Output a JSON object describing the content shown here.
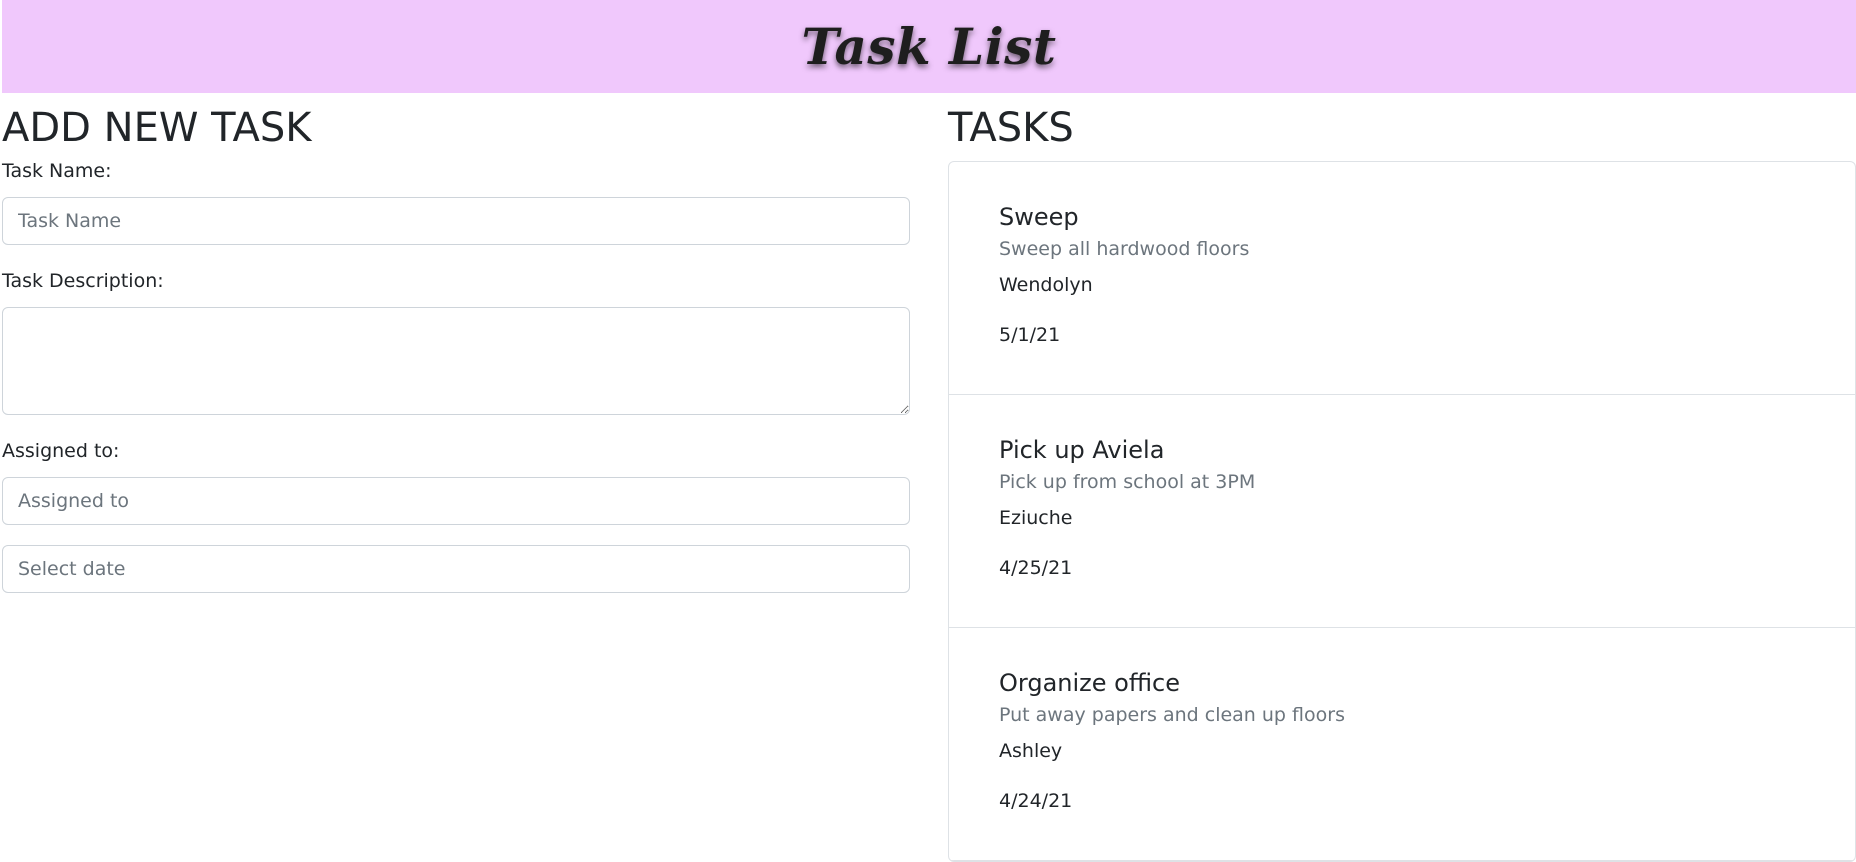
{
  "header": {
    "title": "Task List"
  },
  "form": {
    "heading": "ADD NEW TASK",
    "task_name_label": "Task Name:",
    "task_name_placeholder": "Task Name",
    "task_description_label": "Task Description:",
    "task_description_value": "",
    "assigned_to_label": "Assigned to:",
    "assigned_to_placeholder": "Assigned to",
    "date_placeholder": "Select date"
  },
  "tasks": {
    "heading": "TASKS",
    "items": [
      {
        "name": "Sweep",
        "description": "Sweep all hardwood floors",
        "assignee": "Wendolyn",
        "date": "5/1/21"
      },
      {
        "name": "Pick up Aviela",
        "description": "Pick up from school at 3PM",
        "assignee": "Eziuche",
        "date": "4/25/21"
      },
      {
        "name": "Organize office",
        "description": "Put away papers and clean up floors",
        "assignee": "Ashley",
        "date": "4/24/21"
      }
    ]
  },
  "colors": {
    "header_bg": "#f0c8fc",
    "text": "#212529",
    "muted_text": "#6c757d",
    "border": "#dee2e6"
  }
}
